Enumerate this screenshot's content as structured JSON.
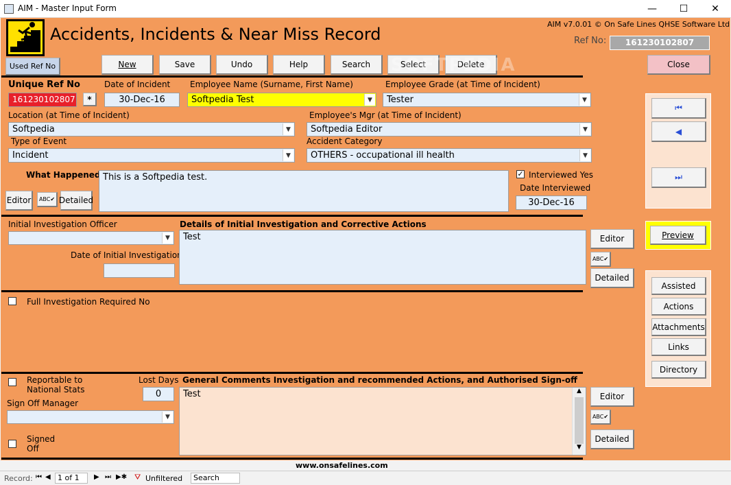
{
  "window": {
    "title": "AIM - Master Input Form",
    "minimize": "—",
    "maximize": "☐",
    "close": "✕"
  },
  "header": {
    "title": "Accidents, Incidents & Near Miss Record",
    "version": "AIM v7.0.01 © On Safe Lines QHSE Software Ltd",
    "ref_label": "Ref No:",
    "ref_value": "161230102807",
    "used_ref_button": "Used Ref No"
  },
  "toolbar": {
    "new": "New",
    "save": "Save",
    "undo": "Undo",
    "help": "Help",
    "search": "Search",
    "select": "Select",
    "delete": "Delete",
    "close": "Close"
  },
  "form": {
    "unique_ref_label": "Unique Ref No",
    "unique_ref_value": "161230102807",
    "star_button": "*",
    "date_label": "Date of Incident",
    "date_value": "30-Dec-16",
    "employee_label": "Employee Name (Surname, First Name)",
    "employee_value": "Softpedia Test",
    "grade_label": "Employee Grade (at Time of Incident)",
    "grade_value": "Tester",
    "location_label": "Location (at Time of Incident)",
    "location_value": "Softpedia",
    "mgr_label": "Employee's Mgr (at Time of Incident)",
    "mgr_value": "Softpedia Editor",
    "event_label": "Type of Event",
    "event_value": "Incident",
    "category_label": "Accident Category",
    "category_value": "OTHERS - occupational ill health",
    "what_happened_label": "What Happened",
    "what_happened_value": "This is a Softpedia test.",
    "editor_button": "Editor",
    "detailed_button": "Detailed",
    "interviewed_label": "Interviewed Yes",
    "date_interviewed_label": "Date Interviewed",
    "date_interviewed_value": "30-Dec-16",
    "initial_officer_label": "Initial Investigation Officer",
    "initial_officer_value": "",
    "date_initial_label": "Date of Initial Investigation",
    "date_initial_value": "",
    "details_label": "Details of Initial Investigation and Corrective Actions",
    "details_value": "Test",
    "full_investigation_label": "Full Investigation Required No",
    "reportable_label_1": "Reportable to",
    "reportable_label_2": "National Stats",
    "lost_days_label": "Lost Days",
    "lost_days_value": "0",
    "signoff_manager_label": "Sign Off Manager",
    "signoff_manager_value": "",
    "signed_off_label_1": "Signed",
    "signed_off_label_2": "Off",
    "comments_label": "General Comments Investigation and recommended Actions, and Authorised Sign-off",
    "comments_value": "Test",
    "website": "www.onsafelines.com"
  },
  "side": {
    "preview": "Preview",
    "assisted": "Assisted",
    "actions": "Actions",
    "attachments": "Attachments",
    "links": "Links",
    "directory": "Directory"
  },
  "status": {
    "record_label": "Record:",
    "record_value": "1 of 1",
    "filter": "Unfiltered",
    "search": "Search"
  },
  "watermark": "SOFTPEDIA",
  "colors": {
    "form_bg": "#f39a5a",
    "ref_red": "#e8202a",
    "highlight_yellow": "#ffff00",
    "field_blue": "#e5effa"
  }
}
